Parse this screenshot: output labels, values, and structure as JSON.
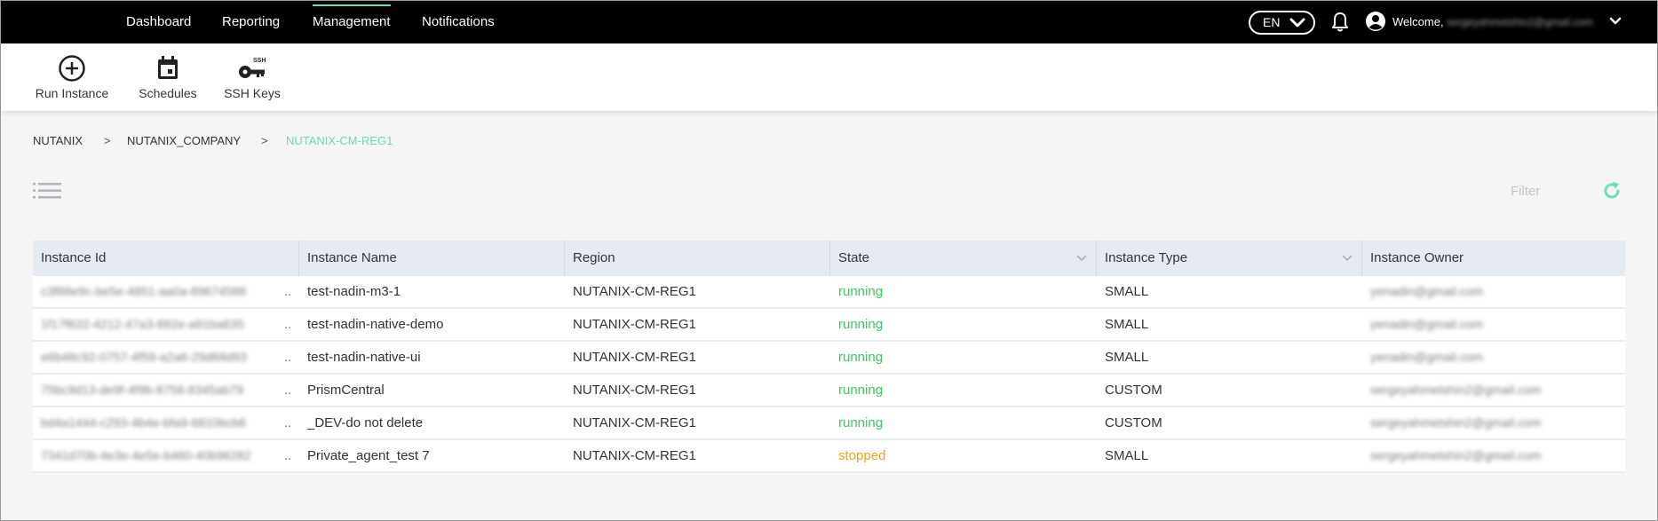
{
  "nav": {
    "items": [
      {
        "label": "Dashboard"
      },
      {
        "label": "Reporting"
      },
      {
        "label": "Management"
      },
      {
        "label": "Notifications"
      }
    ],
    "language": "EN",
    "welcome": "Welcome,",
    "user_email": "sergeyahmetshin2@gmail.com"
  },
  "toolbar": {
    "run_instance": "Run Instance",
    "schedules": "Schedules",
    "ssh_keys": "SSH Keys",
    "ssh_badge": "SSH"
  },
  "breadcrumb": {
    "items": [
      "NUTANIX",
      "NUTANIX_COMPANY",
      "NUTANIX-CM-REG1"
    ],
    "separator": ">"
  },
  "filter": {
    "placeholder": "Filter"
  },
  "table": {
    "columns": [
      "Instance Id",
      "Instance Name",
      "Region",
      "State",
      "Instance Type",
      "Instance Owner"
    ],
    "rows": [
      {
        "id": "c3f88e9c-be5e-4851-aa0a-89674588",
        "name": "test-nadin-m3-1",
        "region": "NUTANIX-CM-REG1",
        "state": "running",
        "type": "SMALL",
        "owner": "yenadin@gmail.com"
      },
      {
        "id": "1f17f632-4212-47a3-892e-a91ba635",
        "name": "test-nadin-native-demo",
        "region": "NUTANIX-CM-REG1",
        "state": "running",
        "type": "SMALL",
        "owner": "yenadin@gmail.com"
      },
      {
        "id": "e6b48c92-0757-4f59-a2a6-29d68d93",
        "name": "test-nadin-native-ui",
        "region": "NUTANIX-CM-REG1",
        "state": "running",
        "type": "SMALL",
        "owner": "yenadin@gmail.com"
      },
      {
        "id": "75bc9d13-de9f-4f9b-8758-8345ab79",
        "name": "PrismCentral",
        "region": "NUTANIX-CM-REG1",
        "state": "running",
        "type": "CUSTOM",
        "owner": "sergeyahmetshin2@gmail.com"
      },
      {
        "id": "bd4a1444-c293-4b4e-bfa9-6810bcb6",
        "name": "_DEV-do not delete",
        "region": "NUTANIX-CM-REG1",
        "state": "running",
        "type": "CUSTOM",
        "owner": "sergeyahmetshin2@gmail.com"
      },
      {
        "id": "7341d70b-4e3e-4e5e-b460-40b96282",
        "name": "Private_agent_test 7",
        "region": "NUTANIX-CM-REG1",
        "state": "stopped",
        "type": "SMALL",
        "owner": "sergeyahmetshin2@gmail.com"
      }
    ]
  },
  "colors": {
    "accent": "#67e0b6",
    "running": "#3cc95f",
    "stopped": "#f0a21d",
    "header_bg": "#000000",
    "table_head_bg": "#e6eaf2"
  },
  "icons": {
    "run_instance": "plus-circle-icon",
    "schedules": "calendar-icon",
    "ssh_keys": "key-icon",
    "notifications": "bell-icon",
    "user": "user-circle-icon",
    "list": "list-icon",
    "refresh": "refresh-icon"
  }
}
